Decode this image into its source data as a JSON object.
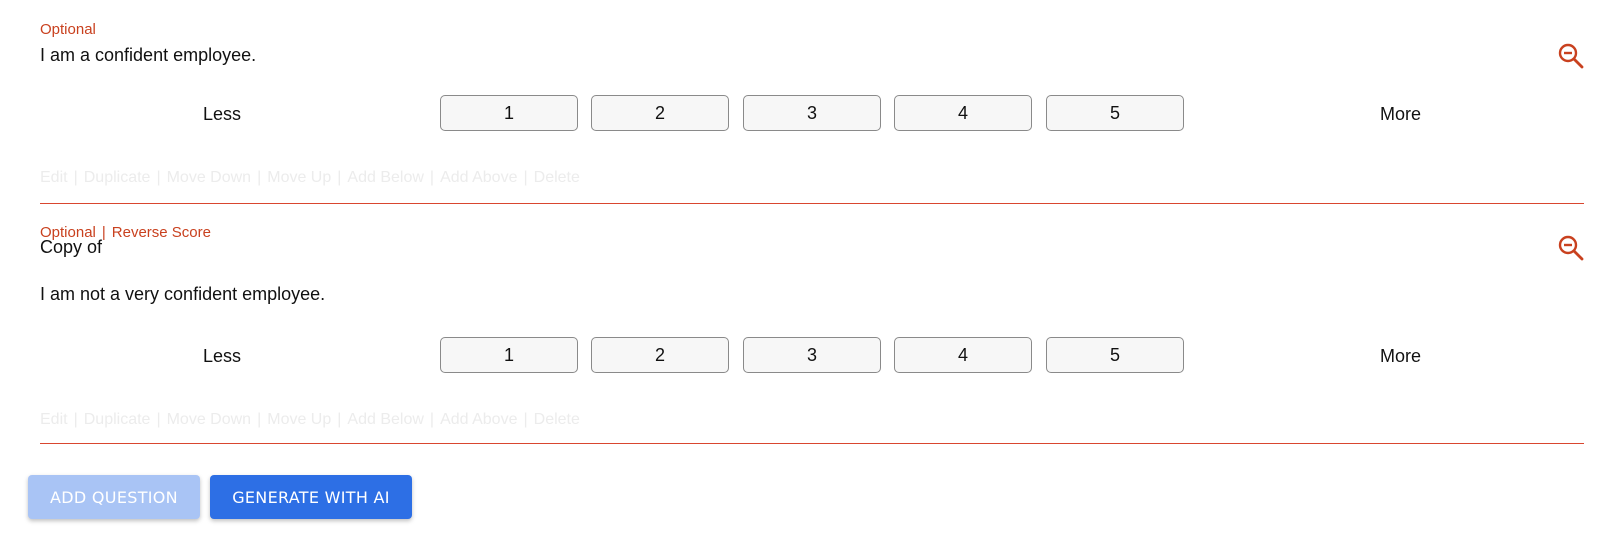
{
  "colors": {
    "accent": "#c9411f",
    "divider": "#d9462f",
    "primary": "#2d6fe5",
    "primary_disabled": "#a9c4f5"
  },
  "questions": [
    {
      "tags": [
        "Optional"
      ],
      "text_lines": [
        "I am a confident employee."
      ],
      "scale": {
        "low_label": "Less",
        "high_label": "More",
        "options": [
          "1",
          "2",
          "3",
          "4",
          "5"
        ]
      },
      "actions": [
        "Edit",
        "Duplicate",
        "Move Down",
        "Move Up",
        "Add Below",
        "Add Above",
        "Delete"
      ],
      "zoom_icon": "zoom-out-icon"
    },
    {
      "tags": [
        "Optional",
        "Reverse Score"
      ],
      "text_lines": [
        "Copy of",
        "I am not a very confident employee."
      ],
      "scale": {
        "low_label": "Less",
        "high_label": "More",
        "options": [
          "1",
          "2",
          "3",
          "4",
          "5"
        ]
      },
      "actions": [
        "Edit",
        "Duplicate",
        "Move Down",
        "Move Up",
        "Add Below",
        "Add Above",
        "Delete"
      ],
      "zoom_icon": "zoom-out-icon"
    }
  ],
  "footer": {
    "add_question_label": "ADD QUESTION",
    "generate_ai_label": "GENERATE WITH AI"
  },
  "separators": {
    "tag": "|",
    "action": "|"
  }
}
